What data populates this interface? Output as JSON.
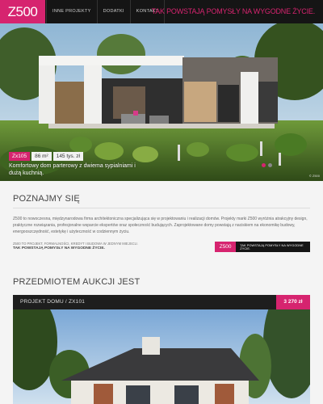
{
  "header": {
    "logo": "Z500",
    "nav": [
      "INNE PROJEKTY",
      "DODATKI",
      "KONTAKT"
    ],
    "tagline": "TAK POWSTAJĄ POMYSŁY NA WYGODNE ŻYCIE."
  },
  "hero": {
    "code": "Zx105",
    "area": "86 m²",
    "price": "145 tys. zł",
    "description": "Komfortowy dom parterowy z dwiema sypialniami i dużą kuchnią.",
    "slides_total": 2,
    "active_slide": 1,
    "copyright": "© Z500"
  },
  "about": {
    "title": "POZNAJMY SIĘ",
    "text": "Z500 to nowoczesna, międzynarodowa firma architektoniczna specjalizująca się w projektowaniu i realizacji domów. Projekty marki Z500 wyróżnia atrakcyjny design, praktyczne rozwiązania, profesjonalne wsparcie ekspertów oraz społeczność budujących. Zaprojektowane domy powstają z naciskiem na ekonomikę budowy, energooszczędność, estetykę i użyteczność w codziennym życiu.",
    "small_line": "Z500 TO PROJEKT, FORMALNOŚCI, KREDYT I BUDOWA W JEDNYM MIEJSCU.",
    "small_bold": "TAK POWSTAJĄ POMYSŁY NA WYGODNE ŻYCIE.",
    "promo_logo": "Z500",
    "promo_text": "TAK POWSTAJĄ POMYSŁY NA WYGODNE ŻYCIE."
  },
  "auction": {
    "title": "PRZEDMIOTEM AUKCJI JEST",
    "label": "PROJEKT DOMU / ZX101",
    "price": "3 270 zł"
  },
  "colors": {
    "accent": "#d6246f",
    "dark": "#151515"
  }
}
